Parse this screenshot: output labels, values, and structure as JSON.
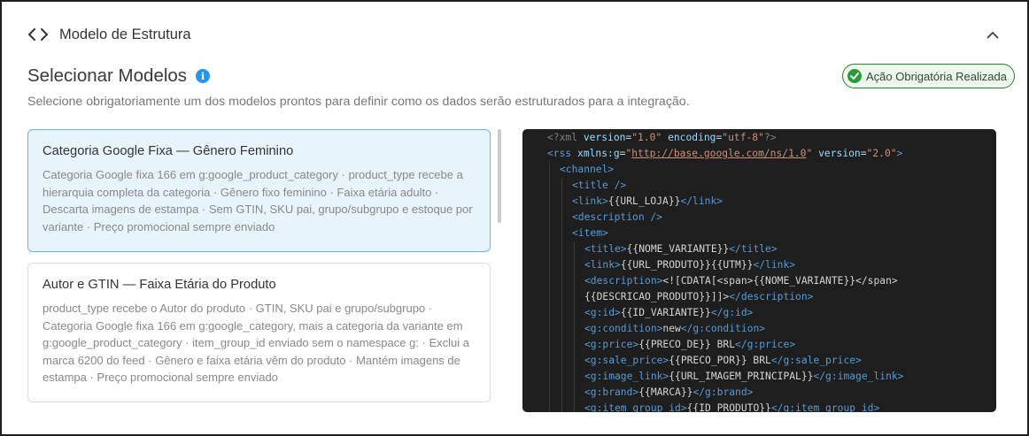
{
  "header": {
    "title": "Modelo de Estrutura",
    "code_icon": "code-brackets-icon",
    "collapse_icon": "chevron-up-icon"
  },
  "section": {
    "title": "Selecionar Modelos",
    "info_icon": "info-icon",
    "subtitle": "Selecione obrigatoriamente um dos modelos prontos para definir como os dados serão estruturados para a integração."
  },
  "status_badge": {
    "label": "Ação Obrigatória Realizada",
    "icon": "check-circle-icon",
    "color": "#2e7d32"
  },
  "models": [
    {
      "title": "Categoria Google Fixa — Gênero Feminino",
      "description": "Categoria Google fixa 166 em g:google_product_category · product_type recebe a hierarquia completa da categoria · Gênero fixo feminino · Faixa etária adulto · Descarta imagens de estampa · Sem GTIN, SKU pai, grupo/subgrupo e estoque por variante · Preço promocional sempre enviado",
      "selected": true
    },
    {
      "title": "Autor e GTIN — Faixa Etária do Produto",
      "description": "product_type recebe o Autor do produto · GTIN, SKU pai e grupo/subgrupo · Categoria Google fixa 166 em g:google_category, mais a categoria da variante em g:google_product_category · item_group_id enviado sem o namespace g: · Exclui a marca 6200 do feed · Gênero e faixa etária vêm do produto · Mantém imagens de estampa · Preço promocional sempre enviado",
      "selected": false
    }
  ],
  "code_preview": [
    [
      [
        "pi",
        "<?xml "
      ],
      [
        "attr",
        "version"
      ],
      [
        "txt",
        "="
      ],
      [
        "str",
        "\"1.0\""
      ],
      [
        "txt",
        " "
      ],
      [
        "attr",
        "encoding"
      ],
      [
        "txt",
        "="
      ],
      [
        "str",
        "\"utf-8\""
      ],
      [
        "pi",
        "?>"
      ]
    ],
    [
      [
        "tag",
        "<rss "
      ],
      [
        "attr",
        "xmlns:g"
      ],
      [
        "txt",
        "="
      ],
      [
        "str",
        "\""
      ],
      [
        "url",
        "http://base.google.com/ns/1.0"
      ],
      [
        "str",
        "\""
      ],
      [
        "txt",
        " "
      ],
      [
        "attr",
        "version"
      ],
      [
        "txt",
        "="
      ],
      [
        "str",
        "\"2.0\""
      ],
      [
        "tag",
        ">"
      ]
    ],
    [
      [
        "tag",
        "<channel>"
      ]
    ],
    [
      [
        "tag",
        "<title />"
      ]
    ],
    [
      [
        "tag",
        "<link>"
      ],
      [
        "txt",
        "{{URL_LOJA}}"
      ],
      [
        "tag",
        "</link>"
      ]
    ],
    [
      [
        "tag",
        "<description />"
      ]
    ],
    [
      [
        "tag",
        "<item>"
      ]
    ],
    [
      [
        "tag",
        "<title>"
      ],
      [
        "txt",
        "{{NOME_VARIANTE}}"
      ],
      [
        "tag",
        "</title>"
      ]
    ],
    [
      [
        "tag",
        "<link>"
      ],
      [
        "txt",
        "{{URL_PRODUTO}}{{UTM}}"
      ],
      [
        "tag",
        "</link>"
      ]
    ],
    [
      [
        "tag",
        "<description>"
      ],
      [
        "txt",
        "<![CDATA[<span>{{NOME_VARIANTE}}</span>"
      ]
    ],
    [
      [
        "txt",
        "{{DESCRICAO_PRODUTO}}]]>"
      ],
      [
        "tag",
        "</description>"
      ]
    ],
    [
      [
        "tag",
        "<g:id>"
      ],
      [
        "txt",
        "{{ID_VARIANTE}}"
      ],
      [
        "tag",
        "</g:id>"
      ]
    ],
    [
      [
        "tag",
        "<g:condition>"
      ],
      [
        "txt",
        "new"
      ],
      [
        "tag",
        "</g:condition>"
      ]
    ],
    [
      [
        "tag",
        "<g:price>"
      ],
      [
        "txt",
        "{{PRECO_DE}} BRL"
      ],
      [
        "tag",
        "</g:price>"
      ]
    ],
    [
      [
        "tag",
        "<g:sale_price>"
      ],
      [
        "txt",
        "{{PRECO_POR}} BRL"
      ],
      [
        "tag",
        "</g:sale_price>"
      ]
    ],
    [
      [
        "tag",
        "<g:image_link>"
      ],
      [
        "txt",
        "{{URL_IMAGEM_PRINCIPAL}}"
      ],
      [
        "tag",
        "</g:image_link>"
      ]
    ],
    [
      [
        "tag",
        "<g:brand>"
      ],
      [
        "txt",
        "{{MARCA}}"
      ],
      [
        "tag",
        "</g:brand>"
      ]
    ],
    [
      [
        "tag",
        "<g:item_group_id>"
      ],
      [
        "txt",
        "{{ID_PRODUTO}}"
      ],
      [
        "tag",
        "</g:item_group_id>"
      ]
    ]
  ]
}
